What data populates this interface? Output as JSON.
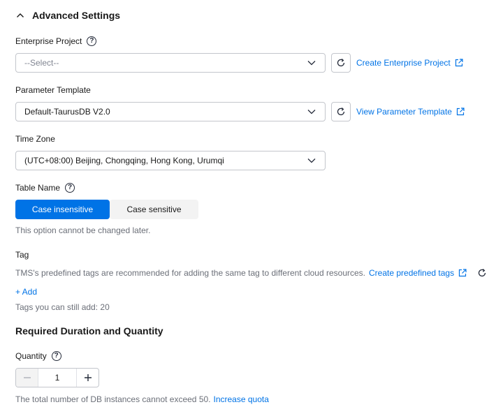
{
  "advanced_settings": {
    "title": "Advanced Settings",
    "expanded": true
  },
  "enterprise_project": {
    "label": "Enterprise Project",
    "placeholder": "--Select--",
    "create_link": "Create Enterprise Project"
  },
  "parameter_template": {
    "label": "Parameter Template",
    "value": "Default-TaurusDB V2.0",
    "view_link": "View Parameter Template"
  },
  "time_zone": {
    "label": "Time Zone",
    "value": "(UTC+08:00) Beijing, Chongqing, Hong Kong, Urumqi"
  },
  "table_name": {
    "label": "Table Name",
    "options": [
      "Case insensitive",
      "Case sensitive"
    ],
    "selected": "Case insensitive",
    "note": "This option cannot be changed later."
  },
  "tag": {
    "label": "Tag",
    "description": "TMS's predefined tags are recommended for adding the same tag to different cloud resources.",
    "create_link": "Create predefined tags",
    "add_label": "+ Add",
    "remaining": "Tags you can still add: 20"
  },
  "duration": {
    "title": "Required Duration and Quantity"
  },
  "quantity": {
    "label": "Quantity",
    "value": "1",
    "note": "The total number of DB instances cannot exceed 50.",
    "quota_link": "Increase quota"
  },
  "colors": {
    "accent": "#0073e6",
    "text": "#191919",
    "muted": "#6b6f78",
    "border": "#c3c6cc"
  }
}
